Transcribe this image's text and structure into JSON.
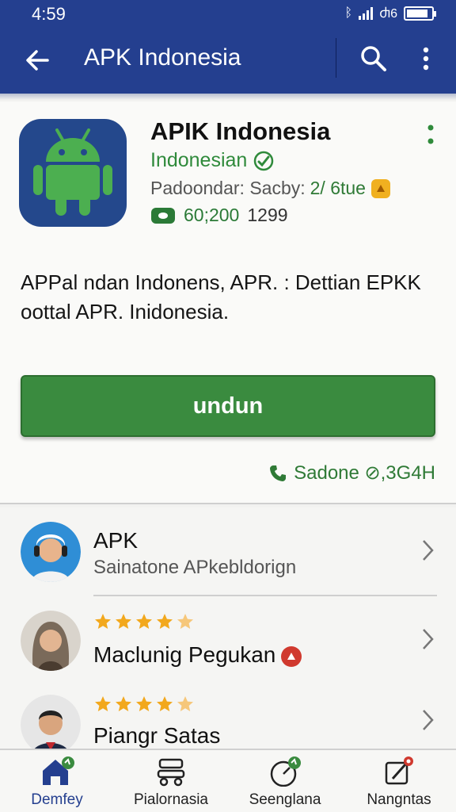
{
  "status_bar": {
    "time": "4:59",
    "icon_text": "ᛒ",
    "wifi_text": "ᕼ",
    "extra_text": "Ⴛ6",
    "battery_level": 0.85
  },
  "app_bar": {
    "title": "APK Indonesia",
    "back_icon": "back-arrow-icon",
    "search_icon": "search-icon",
    "more_icon": "more-vert-icon"
  },
  "app": {
    "name": "APIK Indonesia",
    "language": "Indonesian",
    "developer": "Padoondar: Sacby:",
    "date": "2/ 6tue",
    "downloads": "60;200",
    "downloads_extra": "1299",
    "description": "APPal ndan Indonens, APR. : Dettian EPKK oottal APR. Inidonesia.",
    "download_label": "undun",
    "size_text": "Sadone ⊘,3G4H",
    "colors": {
      "brand": "#243f8f",
      "accent": "#3a8b3f"
    }
  },
  "list": [
    {
      "title": "APK",
      "subtitle": "Sainatone APkebldorign",
      "rating": null
    },
    {
      "title": "Maclunig Pegukan",
      "subtitle": "",
      "rating": 4.5
    },
    {
      "title": "Piangr Satas",
      "subtitle": "",
      "rating": 4.5
    }
  ],
  "bottom_nav": [
    {
      "label": "Demfey",
      "icon": "home-icon"
    },
    {
      "label": "Pialornasia",
      "icon": "apps-icon"
    },
    {
      "label": "Seenglana",
      "icon": "gauge-icon"
    },
    {
      "label": "Nangntas",
      "icon": "edit-icon"
    }
  ]
}
